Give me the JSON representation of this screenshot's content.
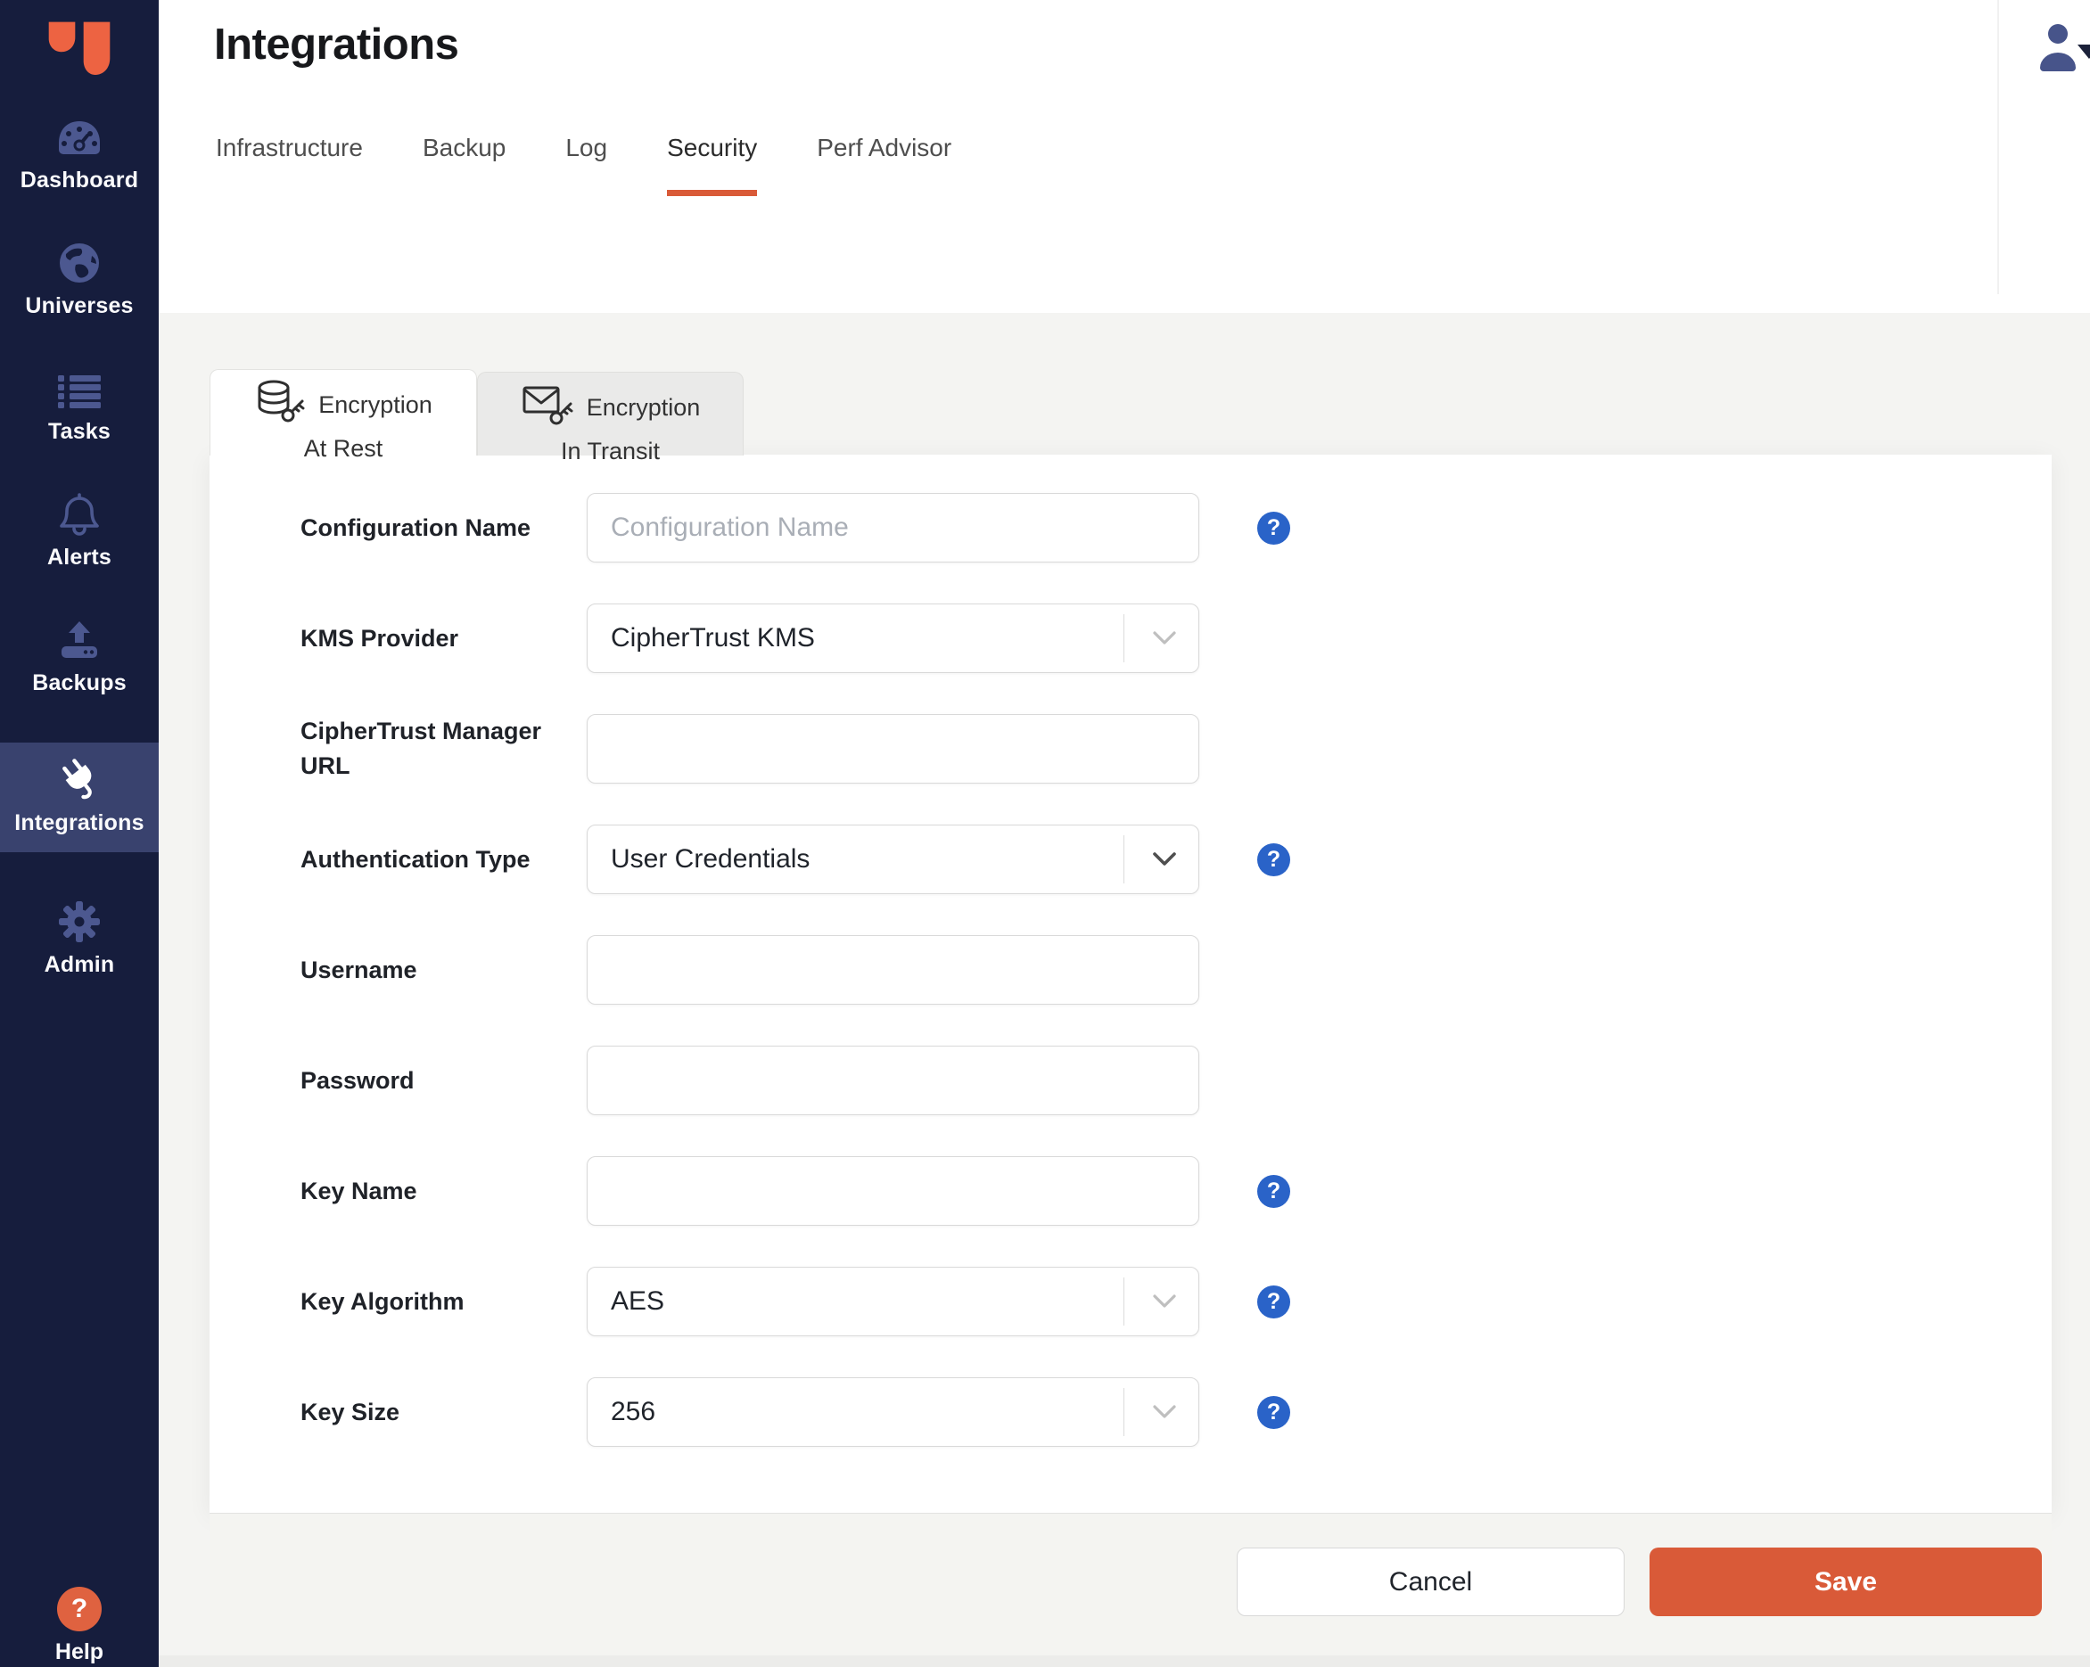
{
  "sidebar": {
    "items": [
      {
        "label": "Dashboard",
        "icon": "gauge-icon",
        "active": false
      },
      {
        "label": "Universes",
        "icon": "globe-icon",
        "active": false
      },
      {
        "label": "Tasks",
        "icon": "list-icon",
        "active": false
      },
      {
        "label": "Alerts",
        "icon": "bell-icon",
        "active": false
      },
      {
        "label": "Backups",
        "icon": "upload-icon",
        "active": false
      },
      {
        "label": "Integrations",
        "icon": "plug-icon",
        "active": true
      },
      {
        "label": "Admin",
        "icon": "gear-icon",
        "active": false
      }
    ],
    "help": {
      "label": "Help",
      "icon": "question-icon"
    }
  },
  "header": {
    "title": "Integrations",
    "tabs": [
      "Infrastructure",
      "Backup",
      "Log",
      "Security",
      "Perf Advisor"
    ],
    "active_tab": "Security"
  },
  "content": {
    "encryption_tabs": [
      {
        "line1": "Encryption",
        "line2": "At Rest",
        "icon": "database-key-icon",
        "active": true
      },
      {
        "line1": "Encryption",
        "line2": "In Transit",
        "icon": "envelope-key-icon",
        "active": false
      }
    ],
    "form": {
      "rows": [
        {
          "label": "Configuration Name",
          "control": "input",
          "placeholder": "Configuration Name",
          "value": "",
          "help": true
        },
        {
          "label": "KMS Provider",
          "control": "select",
          "value": "CipherTrust KMS",
          "help": false
        },
        {
          "label": "CipherTrust Manager URL",
          "control": "input",
          "placeholder": "",
          "value": "",
          "help": false
        },
        {
          "label": "Authentication Type",
          "control": "select",
          "value": "User Credentials",
          "help": true
        },
        {
          "label": "Username",
          "control": "input",
          "placeholder": "",
          "value": "",
          "help": false
        },
        {
          "label": "Password",
          "control": "input",
          "placeholder": "",
          "value": "",
          "help": false
        },
        {
          "label": "Key Name",
          "control": "input",
          "placeholder": "",
          "value": "",
          "help": true
        },
        {
          "label": "Key Algorithm",
          "control": "select",
          "value": "AES",
          "help": true
        },
        {
          "label": "Key Size",
          "control": "select",
          "value": "256",
          "help": true
        }
      ]
    },
    "footer": {
      "cancel_label": "Cancel",
      "save_label": "Save"
    }
  },
  "colors": {
    "accent_orange": "#D95A38",
    "logo_orange": "#ED6342",
    "sidebar_bg": "#161D3D",
    "sidebar_active_bg": "#39426E",
    "sidebar_icon": "#4C5890",
    "help_blue": "#2A63C8",
    "help_badge_orange": "#DF6240",
    "content_bg": "#F4F4F2"
  }
}
